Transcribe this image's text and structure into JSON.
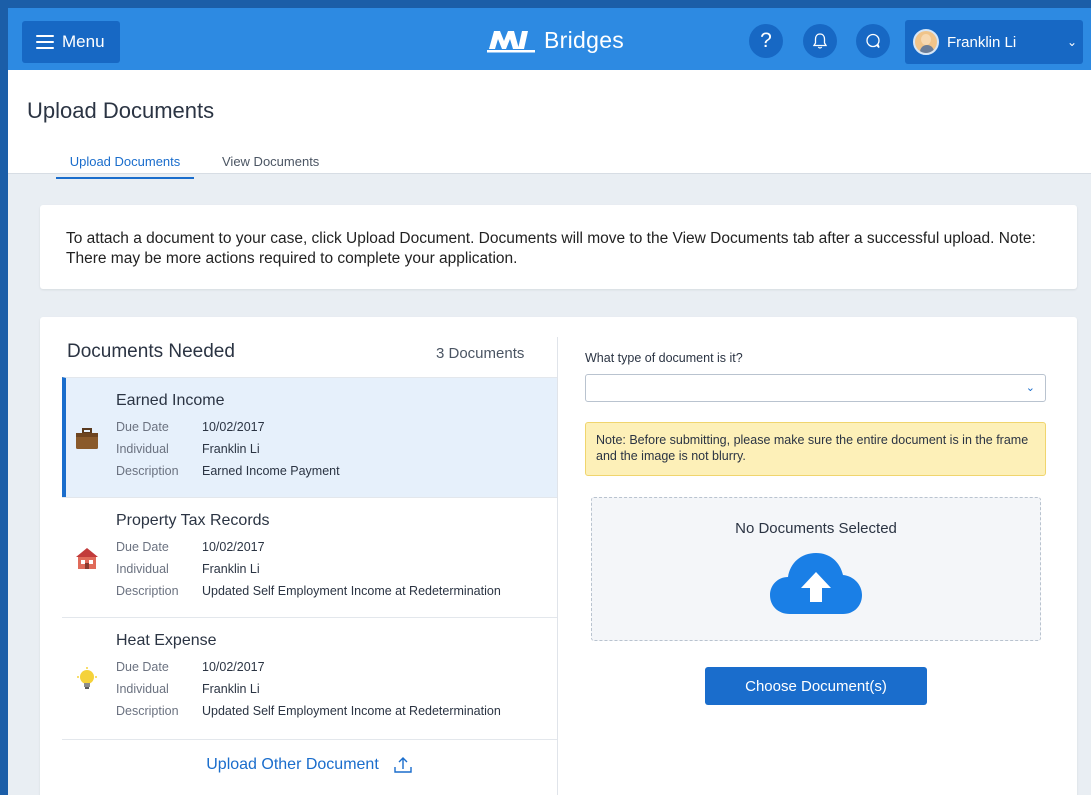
{
  "header": {
    "menu_label": "Menu",
    "logo_text": "Bridges",
    "logo_mark": "MI",
    "help_label": "?",
    "user_name": "Franklin Li",
    "accent": "#2d8ae2"
  },
  "page": {
    "title": "Upload Documents",
    "tabs": [
      {
        "label": "Upload Documents",
        "active": true
      },
      {
        "label": "View Documents",
        "active": false
      }
    ],
    "info_text": "To attach a document to your case, click Upload Document. Documents will move to the View Documents tab after a successful upload. Note: There may be more actions required to complete your application."
  },
  "documents": {
    "heading": "Documents Needed",
    "count_label": "3 Documents",
    "keys": {
      "due": "Due Date",
      "individual": "Individual",
      "description": "Description"
    },
    "items": [
      {
        "name": "Earned Income",
        "icon": "briefcase-icon",
        "due": "10/02/2017",
        "individual": "Franklin Li",
        "description": "Earned Income Payment",
        "selected": true
      },
      {
        "name": "Property Tax Records",
        "icon": "house-icon",
        "due": "10/02/2017",
        "individual": "Franklin Li",
        "description": "Updated Self Employment Income at Redetermination",
        "selected": false
      },
      {
        "name": "Heat Expense",
        "icon": "lightbulb-icon",
        "due": "10/02/2017",
        "individual": "Franklin Li",
        "description": "Updated Self Employment Income at Redetermination",
        "selected": false
      }
    ],
    "upload_other_label": "Upload Other Document"
  },
  "upload_panel": {
    "type_label": "What type of document is it?",
    "type_value": "",
    "note": "Note: Before submitting, please make sure the entire document is in the frame and the image is not blurry.",
    "drop_text": "No Documents Selected",
    "choose_label": "Choose Document(s)"
  }
}
